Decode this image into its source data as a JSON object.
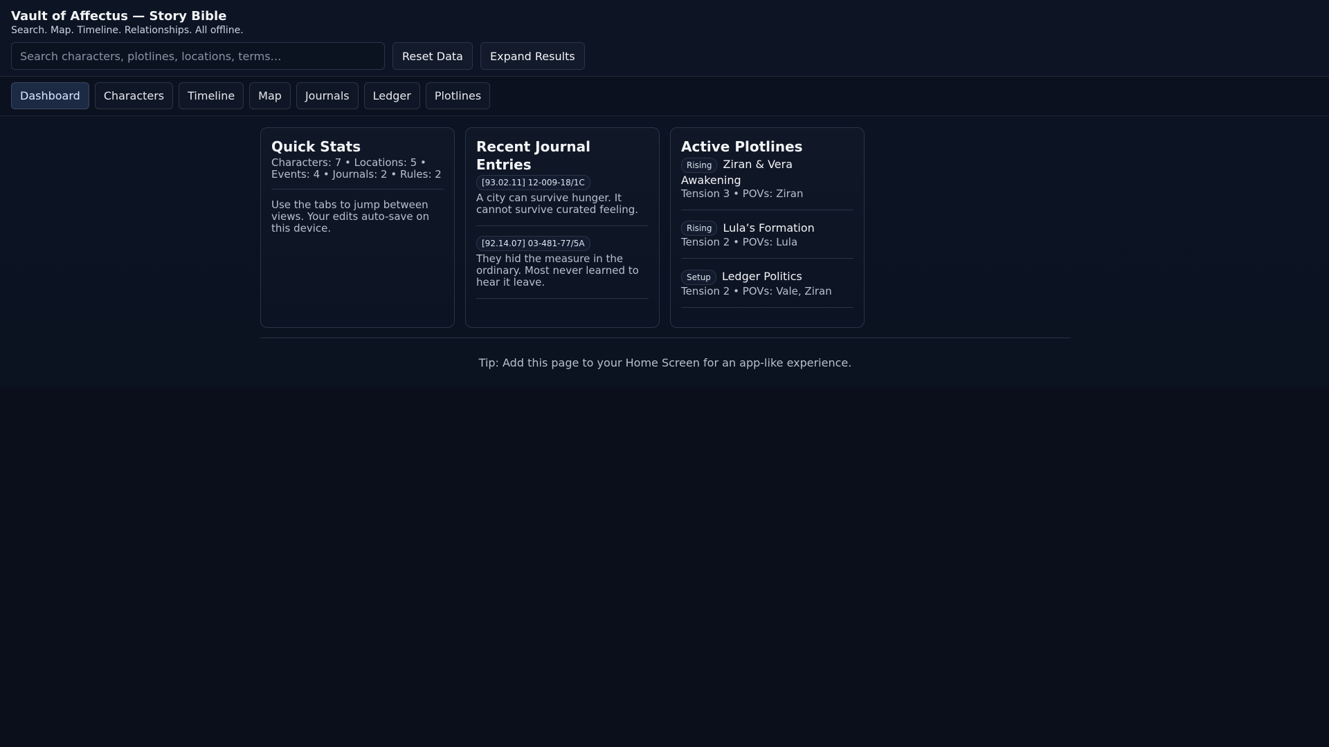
{
  "header": {
    "title": "Vault of Affectus — Story Bible",
    "subtitle": "Search. Map. Timeline. Relationships. All offline.",
    "search_placeholder": "Search characters, plotlines, locations, terms…",
    "reset_label": "Reset Data",
    "expand_label": "Expand Results"
  },
  "tabs": [
    {
      "label": "Dashboard",
      "active": true
    },
    {
      "label": "Characters"
    },
    {
      "label": "Timeline"
    },
    {
      "label": "Map"
    },
    {
      "label": "Journals"
    },
    {
      "label": "Ledger"
    },
    {
      "label": "Plotlines"
    }
  ],
  "quick_stats": {
    "title": "Quick Stats",
    "stats": "Characters: 7 • Locations: 5 • Events: 4 • Journals: 2 • Rules: 2",
    "help": "Use the tabs to jump between views. Your edits auto-save on this device."
  },
  "journals": {
    "title": "Recent Journal Entries",
    "entries": [
      {
        "tag": "[93.02.11] 12-009-18/1C",
        "text": "A city can survive hunger. It cannot survive curated feeling."
      },
      {
        "tag": "[92.14.07] 03-481-77/5A",
        "text": "They hid the measure in the ordinary. Most never learned to hear it leave."
      }
    ]
  },
  "plotlines": {
    "title": "Active Plotlines",
    "items": [
      {
        "status": "Rising",
        "name": "Ziran & Vera Awakening",
        "meta": "Tension 3 • POVs: Ziran"
      },
      {
        "status": "Rising",
        "name": "Lula’s Formation",
        "meta": "Tension 2 • POVs: Lula"
      },
      {
        "status": "Setup",
        "name": "Ledger Politics",
        "meta": "Tension 2 • POVs: Vale, Ziran"
      }
    ]
  },
  "footer": {
    "tip": "Tip: Add this page to your Home Screen for an app-like experience."
  }
}
